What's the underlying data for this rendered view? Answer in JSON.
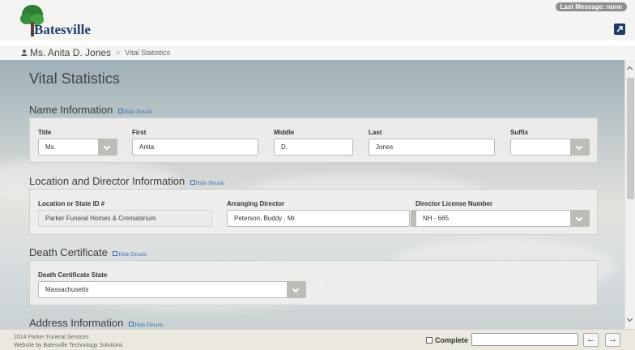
{
  "header": {
    "logo_text": "Batesville",
    "last_message": "Last Message: none",
    "popout_icon": "external-link-icon"
  },
  "breadcrumb": {
    "person": "Ms. Anita D. Jones",
    "separator": ">",
    "current": "Vital Statistics"
  },
  "page": {
    "title": "Vital Statistics",
    "hide_details": "Hide Details"
  },
  "name_info": {
    "title": "Name Information",
    "title_label": "Title",
    "title_value": "Ms.",
    "first_label": "First",
    "first_value": "Anita",
    "middle_label": "Middle",
    "middle_value": "D.",
    "last_label": "Last",
    "last_value": "Jones",
    "suffix_label": "Suffix",
    "suffix_value": ""
  },
  "location_info": {
    "title": "Location and Director Information",
    "location_label": "Location or State ID #",
    "location_value": "Parker Funeral Homes & Crematorium",
    "director_label": "Arranging Director",
    "director_value": "Peterson, Buddy , Mr.",
    "license_label": "Director License Number",
    "license_value": "NH - 665"
  },
  "death_certificate": {
    "title": "Death Certificate",
    "state_label": "Death Certificate State",
    "state_value": "Massachusetts"
  },
  "address_info": {
    "title": "Address Information"
  },
  "footer": {
    "line1": "2014 Parker Funeral Services",
    "line2": "Website by Batesville Technology Solutions",
    "complete_label": "Complete",
    "prev_label": "←",
    "next_label": "→"
  },
  "colors": {
    "brand": "#1f3c6e",
    "link": "#3a6fb2",
    "button_gray": "#bdbdb7"
  }
}
